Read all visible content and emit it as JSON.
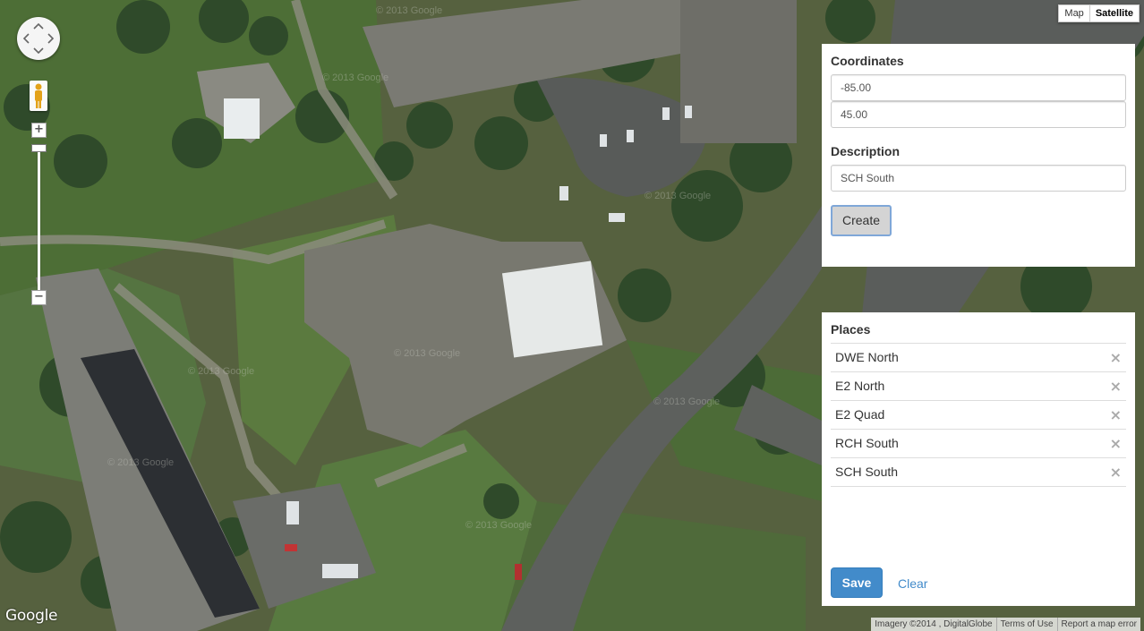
{
  "map": {
    "type_options": [
      "Map",
      "Satellite"
    ],
    "active_type": "Satellite",
    "zoom_in": "+",
    "zoom_out": "−",
    "logo": "Google",
    "attribution": [
      "Imagery ©2014 , DigitalGlobe",
      "Terms of Use",
      "Report a map error"
    ]
  },
  "coordinates": {
    "heading": "Coordinates",
    "longitude": "-85.00",
    "latitude": "45.00",
    "description_heading": "Description",
    "description": "SCH South",
    "create_label": "Create"
  },
  "places": {
    "heading": "Places",
    "items": [
      {
        "name": "DWE North",
        "remove": "×"
      },
      {
        "name": "E2 North",
        "remove": "×"
      },
      {
        "name": "E2 Quad",
        "remove": "×"
      },
      {
        "name": "RCH South",
        "remove": "×"
      },
      {
        "name": "SCH South",
        "remove": "×"
      }
    ],
    "save_label": "Save",
    "clear_label": "Clear"
  },
  "colors": {
    "primary": "#428bca",
    "grass": "#4a6b3a",
    "road": "#5b5e5c",
    "roof": "#7b7b77"
  }
}
